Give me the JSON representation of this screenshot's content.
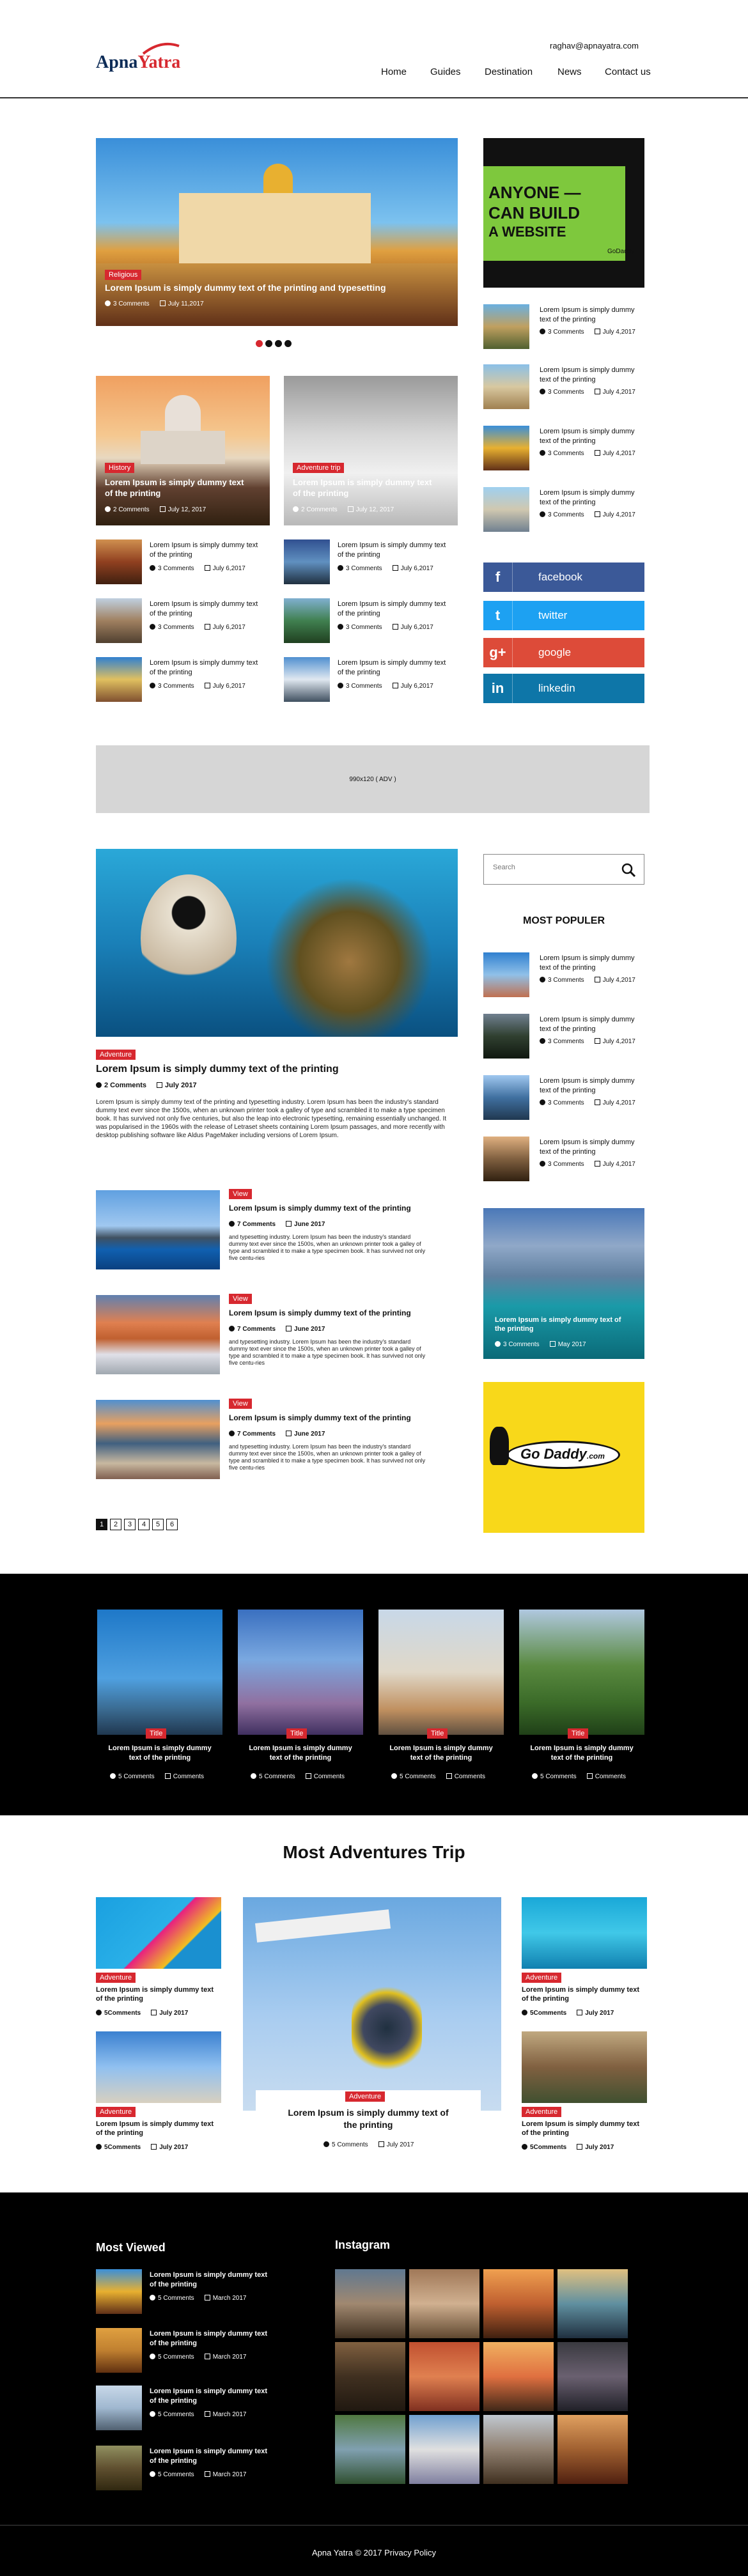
{
  "header": {
    "logo_main": "Apna",
    "logo_accent": "Yatra",
    "email": "raghav@apnayatra.com",
    "nav": [
      "Home",
      "Guides",
      "Destination",
      "News",
      "Contact us"
    ]
  },
  "slider": {
    "tag": "Religious",
    "title": "Lorem Ipsum is simply dummy text of the printing and typesetting",
    "comments": "3 Comments",
    "date": "July 11,2017"
  },
  "ad_banner": {
    "line1": "ANYONE —",
    "line2": "CAN BUILD",
    "line3": "A WEBSITE",
    "brand": "GoDaddy"
  },
  "sidebar_posts": [
    {
      "title": "Lorem Ipsum is simply dummy text of the printing",
      "comments": "3 Comments",
      "date": "July 4,2017"
    },
    {
      "title": "Lorem Ipsum is simply dummy text of the printing",
      "comments": "3 Comments",
      "date": "July 4,2017"
    },
    {
      "title": "Lorem Ipsum is simply dummy text of the printing",
      "comments": "3 Comments",
      "date": "July 4,2017"
    },
    {
      "title": "Lorem Ipsum is simply dummy text of the printing",
      "comments": "3 Comments",
      "date": "July 4,2017"
    }
  ],
  "featured": [
    {
      "tag": "History",
      "title": "Lorem Ipsum is simply dummy text of the printing",
      "comments": "2 Comments",
      "date": "July 12, 2017"
    },
    {
      "tag": "Adventure trip",
      "title": "Lorem Ipsum is simply dummy text of the printing",
      "comments": "2 Comments",
      "date": "July 12, 2017"
    }
  ],
  "grid_posts": [
    {
      "title": "Lorem Ipsum is simply dummy text of the printing",
      "comments": "3 Comments",
      "date": "July 6,2017"
    },
    {
      "title": "Lorem Ipsum is simply dummy text of the printing",
      "comments": "3 Comments",
      "date": "July 6,2017"
    },
    {
      "title": "Lorem Ipsum is simply dummy text of the printing",
      "comments": "3 Comments",
      "date": "July 6,2017"
    },
    {
      "title": "Lorem Ipsum is simply dummy text of the printing",
      "comments": "3 Comments",
      "date": "July 6,2017"
    },
    {
      "title": "Lorem Ipsum is simply dummy text of the printing",
      "comments": "3 Comments",
      "date": "July 6,2017"
    },
    {
      "title": "Lorem Ipsum is simply dummy text of the printing",
      "comments": "3 Comments",
      "date": "July 6,2017"
    }
  ],
  "social": [
    "facebook",
    "twitter",
    "google",
    "linkedin"
  ],
  "ad_placeholder": "990x120 ( ADV )",
  "main_post": {
    "tag": "Adventure",
    "title": "Lorem Ipsum is simply dummy text of the printing",
    "comments": "2 Comments",
    "date": "July 2017",
    "body": "Lorem Ipsum is simply dummy text of the printing and typesetting industry. Lorem Ipsum has been the industry's standard dummy text ever since the 1500s, when an unknown printer took a galley of type and scrambled it to make a type specimen book. It has survived not only five centuries, but also the leap into electronic typesetting, remaining essentially unchanged. It was popularised in the 1960s with the release of Letraset sheets containing Lorem Ipsum passages, and more recently with desktop publishing software like Aldus PageMaker including versions of Lorem Ipsum."
  },
  "list_posts": [
    {
      "tag": "View",
      "title": "Lorem Ipsum is simply dummy text of the printing",
      "comments": "7 Comments",
      "date": "June 2017",
      "body": "and typesetting industry. Lorem Ipsum has been the industry's standard dummy text ever since the 1500s, when an unknown printer took a galley of type and scrambled it to make a type specimen book. It has survived not only five centu-ries"
    },
    {
      "tag": "View",
      "title": "Lorem Ipsum is simply dummy text of the printing",
      "comments": "7 Comments",
      "date": "June 2017",
      "body": "and typesetting industry. Lorem Ipsum has been the industry's standard dummy text ever since the 1500s, when an unknown printer took a galley of type and scrambled it to make a type specimen book. It has survived not only five centu-ries"
    },
    {
      "tag": "View",
      "title": "Lorem Ipsum is simply dummy text of the printing",
      "comments": "7 Comments",
      "date": "June 2017",
      "body": "and typesetting industry. Lorem Ipsum has been the industry's standard dummy text ever since the 1500s, when an unknown printer took a galley of type and scrambled it to make a type specimen book. It has survived not only five centu-ries"
    }
  ],
  "pagination": [
    "1",
    "2",
    "3",
    "4",
    "5",
    "6"
  ],
  "search": {
    "placeholder": "Search"
  },
  "popular": {
    "heading": "MOST POPULER",
    "items": [
      {
        "title": "Lorem Ipsum is simply dummy text of the printing",
        "comments": "3 Comments",
        "date": "July 4,2017"
      },
      {
        "title": "Lorem Ipsum is simply dummy text of the printing",
        "comments": "3 Comments",
        "date": "July 4,2017"
      },
      {
        "title": "Lorem Ipsum is simply dummy text of the printing",
        "comments": "3 Comments",
        "date": "July 4,2017"
      },
      {
        "title": "Lorem Ipsum is simply dummy text of the printing",
        "comments": "3 Comments",
        "date": "July 4,2017"
      }
    ]
  },
  "lake_card": {
    "title": "Lorem Ipsum is simply dummy text of the printing",
    "comments": "3 Comments",
    "date": "May 2017"
  },
  "godaddy_ad": {
    "brand": "Go Daddy",
    "suffix": ".com"
  },
  "landmarks": [
    {
      "tag": "Title",
      "title": "Lorem Ipsum is simply dummy text of the printing",
      "comments": "5 Comments",
      "extra": "Comments"
    },
    {
      "tag": "Title",
      "title": "Lorem Ipsum is simply dummy text of the printing",
      "comments": "5 Comments",
      "extra": "Comments"
    },
    {
      "tag": "Title",
      "title": "Lorem Ipsum is simply dummy text of the printing",
      "comments": "5 Comments",
      "extra": "Comments"
    },
    {
      "tag": "Title",
      "title": "Lorem Ipsum is simply dummy text of the printing",
      "comments": "5 Comments",
      "extra": "Comments"
    }
  ],
  "adventures": {
    "heading": "Most Adventures Trip",
    "small": [
      {
        "tag": "Adventure",
        "title": "Lorem Ipsum is simply dummy text of the printing",
        "comments": "5Comments",
        "date": "July 2017"
      },
      {
        "tag": "Adventure",
        "title": "Lorem Ipsum is simply dummy text of the printing",
        "comments": "5Comments",
        "date": "July 2017"
      },
      {
        "tag": "Adventure",
        "title": "Lorem Ipsum is simply dummy text of the printing",
        "comments": "5Comments",
        "date": "July 2017"
      },
      {
        "tag": "Adventure",
        "title": "Lorem Ipsum is simply dummy text of the printing",
        "comments": "5Comments",
        "date": "July 2017"
      }
    ],
    "center": {
      "tag": "Adventure",
      "title": "Lorem Ipsum is simply dummy text of the printing",
      "comments": "5 Comments",
      "date": "July 2017"
    }
  },
  "footer": {
    "most_viewed_heading": "Most Viewed",
    "instagram_heading": "Instagram",
    "most_viewed": [
      {
        "title": "Lorem Ipsum is simply dummy text of the printing",
        "comments": "5 Comments",
        "date": "March 2017"
      },
      {
        "title": "Lorem Ipsum is simply dummy text of the printing",
        "comments": "5 Comments",
        "date": "March 2017"
      },
      {
        "title": "Lorem Ipsum is simply dummy text of the printing",
        "comments": "5 Comments",
        "date": "March 2017"
      },
      {
        "title": "Lorem Ipsum is simply dummy text of the printing",
        "comments": "5 Comments",
        "date": "March 2017"
      }
    ],
    "copyright": "Apna Yatra © 2017 Privacy Policy"
  }
}
